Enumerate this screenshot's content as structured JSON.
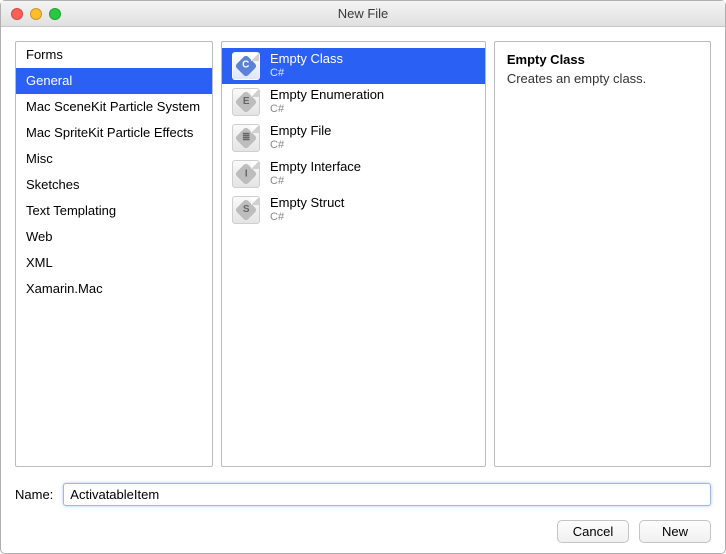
{
  "window": {
    "title": "New File"
  },
  "traffic": {
    "close": "#ff5f57",
    "min": "#ffbd2e",
    "max": "#28c940"
  },
  "categories": [
    {
      "label": "Forms",
      "selected": false
    },
    {
      "label": "General",
      "selected": true
    },
    {
      "label": "Mac SceneKit Particle System",
      "selected": false
    },
    {
      "label": "Mac SpriteKit Particle Effects",
      "selected": false
    },
    {
      "label": "Misc",
      "selected": false
    },
    {
      "label": "Sketches",
      "selected": false
    },
    {
      "label": "Text Templating",
      "selected": false
    },
    {
      "label": "Web",
      "selected": false
    },
    {
      "label": "XML",
      "selected": false
    },
    {
      "label": "Xamarin.Mac",
      "selected": false
    }
  ],
  "items": [
    {
      "name": "Empty Class",
      "lang": "C#",
      "glyph": "C",
      "selected": true
    },
    {
      "name": "Empty Enumeration",
      "lang": "C#",
      "glyph": "E",
      "selected": false
    },
    {
      "name": "Empty File",
      "lang": "C#",
      "glyph": "≣",
      "selected": false
    },
    {
      "name": "Empty Interface",
      "lang": "C#",
      "glyph": "I",
      "selected": false
    },
    {
      "name": "Empty Struct",
      "lang": "C#",
      "glyph": "S",
      "selected": false
    }
  ],
  "description": {
    "title": "Empty Class",
    "body": "Creates an empty class."
  },
  "nameField": {
    "label": "Name:",
    "value": "ActivatableItem"
  },
  "buttons": {
    "cancel": "Cancel",
    "confirm": "New"
  }
}
